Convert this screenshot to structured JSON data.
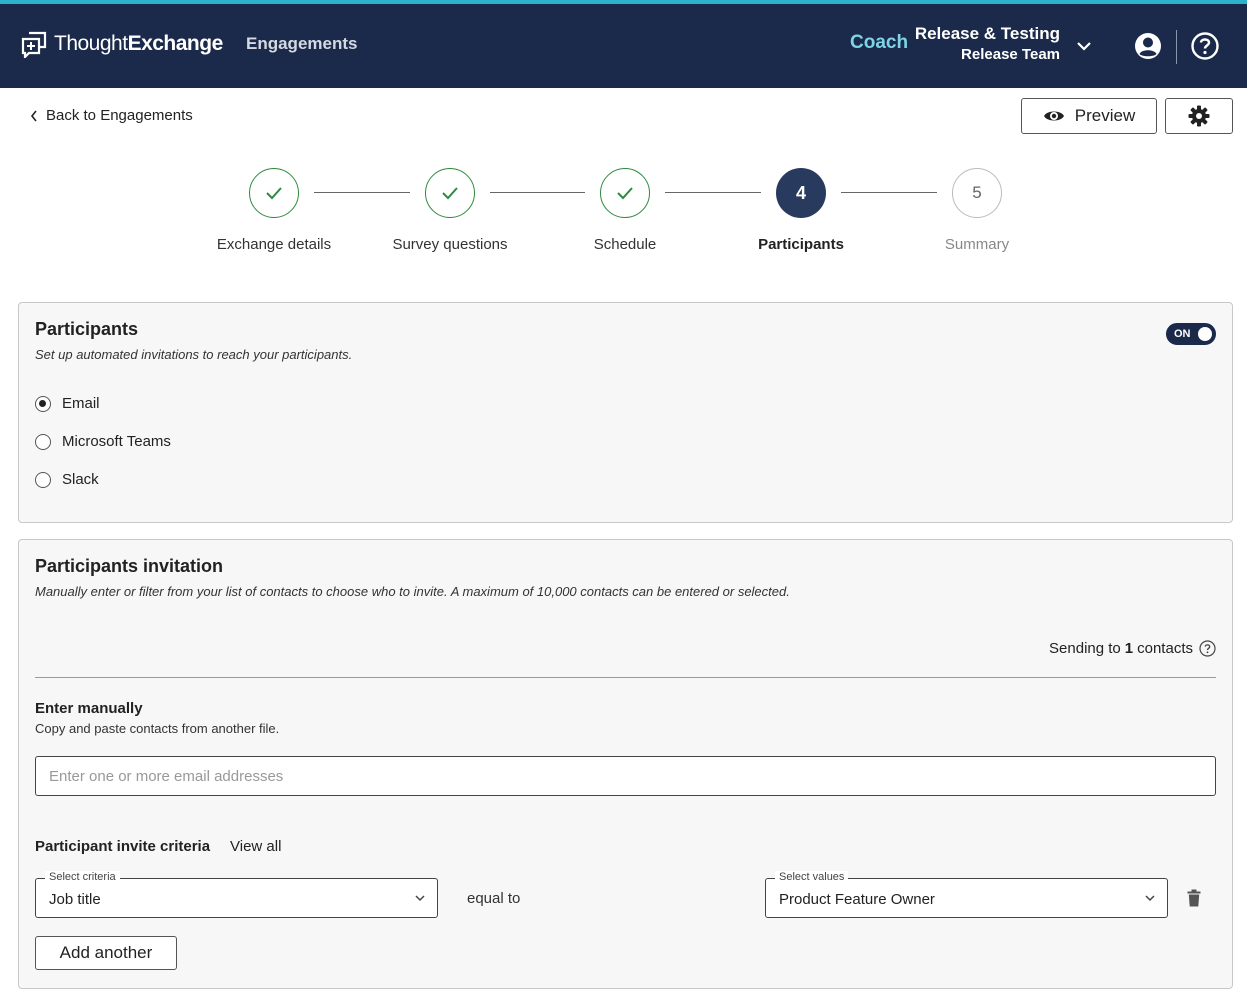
{
  "header": {
    "logo_light": "Thought",
    "logo_bold": "Exchange",
    "nav_engagements": "Engagements",
    "coach": "Coach",
    "org_name": "Release & Testing",
    "team_name": "Release Team",
    "colors": {
      "bar": "#1b2a4a",
      "accent_top": "#2bb3c9",
      "coach": "#7fd3e6"
    }
  },
  "toolbar": {
    "back_label": "Back to Engagements",
    "preview_label": "Preview"
  },
  "stepper": {
    "steps": [
      {
        "number": "1",
        "label": "Exchange details",
        "state": "done"
      },
      {
        "number": "2",
        "label": "Survey questions",
        "state": "done"
      },
      {
        "number": "3",
        "label": "Schedule",
        "state": "done"
      },
      {
        "number": "4",
        "label": "Participants",
        "state": "active"
      },
      {
        "number": "5",
        "label": "Summary",
        "state": "pending"
      }
    ]
  },
  "participants": {
    "title": "Participants",
    "subtitle": "Set up automated invitations to reach your participants.",
    "toggle_label": "ON",
    "channels": [
      {
        "label": "Email",
        "selected": true
      },
      {
        "label": "Microsoft Teams",
        "selected": false
      },
      {
        "label": "Slack",
        "selected": false
      }
    ]
  },
  "invitation": {
    "title": "Participants invitation",
    "subtitle": "Manually enter or filter from your list of contacts to choose who to invite. A maximum of 10,000 contacts can be entered or selected.",
    "sending_prefix": "Sending to",
    "sending_count": "1",
    "sending_suffix": "contacts",
    "manual_title": "Enter manually",
    "manual_sub": "Copy and paste contacts from another file.",
    "email_placeholder": "Enter one or more email addresses",
    "criteria_title": "Participant invite criteria",
    "view_all": "View all",
    "criteria_legend": "Select criteria",
    "criteria_value": "Job title",
    "operator": "equal to",
    "values_legend": "Select values",
    "values_value": "Product Feature Owner",
    "add_another": "Add another"
  }
}
